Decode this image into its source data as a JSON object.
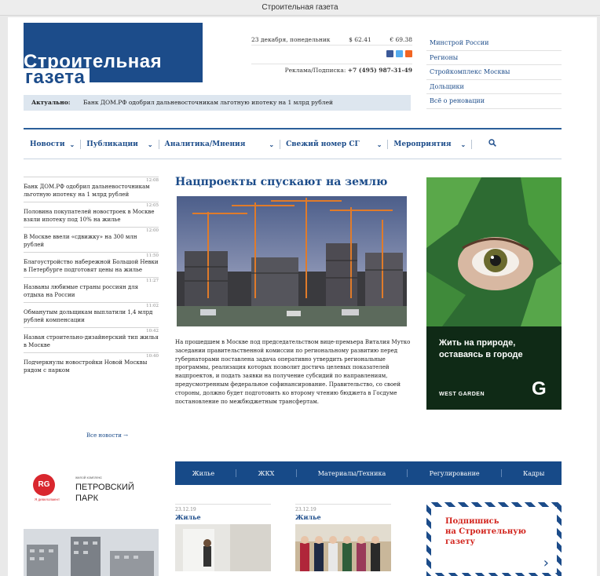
{
  "browser": {
    "tab_title": "Строительная газета"
  },
  "logo": {
    "line1": "Строительная",
    "line2": "газета"
  },
  "header": {
    "date": "23 декабря, понедельник",
    "usd": "$ 62.41",
    "eur": "€ 69.38",
    "ad_label": "Реклама/Подписка:",
    "ad_phone": "+7 (495) 987-31-49"
  },
  "top_links": [
    "Минстрой России",
    "Регионы",
    "Стройкомплекс Москвы",
    "Дольщики",
    "Всё о реновации"
  ],
  "aktual": {
    "label": "Актуально:",
    "text": "Банк ДОМ.РФ одобрил дальневосточникам льготную ипотеку на 1 млрд рублей"
  },
  "nav": {
    "items": [
      "Новости",
      "Публикации",
      "Аналитика/Мнения",
      "Свежий номер СГ",
      "Мероприятия"
    ],
    "search_icon": "search-icon"
  },
  "feed": {
    "items": [
      {
        "time": "12:08",
        "text": "Банк ДОМ.РФ одобрил дальневосточникам льготную ипотеку на 1 млрд рублей"
      },
      {
        "time": "12:05",
        "text": "Половина покупателей новостроек в Москве взяли ипотеку под 10% на жилье"
      },
      {
        "time": "12:00",
        "text": "В Москве ввели «сдвижку» на 300 млн рублей"
      },
      {
        "time": "11:50",
        "text": "Благоустройство набережной Большой Невки в Петербурге подготовят цены на жилье"
      },
      {
        "time": "11:27",
        "text": "Названы любимые страны россиян для отдыха на России"
      },
      {
        "time": "11:02",
        "text": "Обманутым дольщикам выплатили 1,4 млрд рублей компенсации"
      },
      {
        "time": "10:42",
        "text": "Назван строительно-дизайнерский тип жилья в Москве"
      },
      {
        "time": "10:40",
        "text": "Подчеркнулы новостройки Новой Москвы рядом с парком"
      }
    ],
    "all_news": "Все новости"
  },
  "main": {
    "headline": "Нацпроекты спускают на землю",
    "lead": "На прошедшем в Москве под председательством вице-премьера Виталия Мутко заседании правительственной комиссии по региональному развитию перед губернаторами поставлена задача оперативно утвердить региональные программы, реализация которых позволит достичь целевых показателей нацпроектов, и подать заявки на получение субсидий по направлениям, предусмотренным федеральное софинансирование. Правительство, со своей стороны, должно будет подготовить ко второму чтению бюджета в Госдуме постановление по межбюджетным трансфертам."
  },
  "banner": {
    "text_line1": "Жить на природе,",
    "text_line2": "оставаясь в городе",
    "brand": "WEST GARDEN",
    "mark": "G"
  },
  "categories": [
    "Жилье",
    "ЖКХ",
    "Материалы/Техника",
    "Регулирование",
    "Кадры"
  ],
  "cards": [
    {
      "date": "23.12.19",
      "tag": "Жилье"
    },
    {
      "date": "23.12.19",
      "tag": "Жилье"
    }
  ],
  "subscribe": {
    "line1": "Подпишись",
    "line2": "на Строительную",
    "line3": "газету",
    "arrow": "›"
  },
  "ad2": {
    "logo": "RG",
    "logo_sub": "Я девелопмент",
    "caption": "жилой комплекс",
    "name_line1": "ПЕТРОВСКИЙ",
    "name_line2": "ПАРК"
  },
  "colors": {
    "brand": "#1c4c8a",
    "accent_red": "#d2241d",
    "banner_bg": "#0f2a16"
  }
}
